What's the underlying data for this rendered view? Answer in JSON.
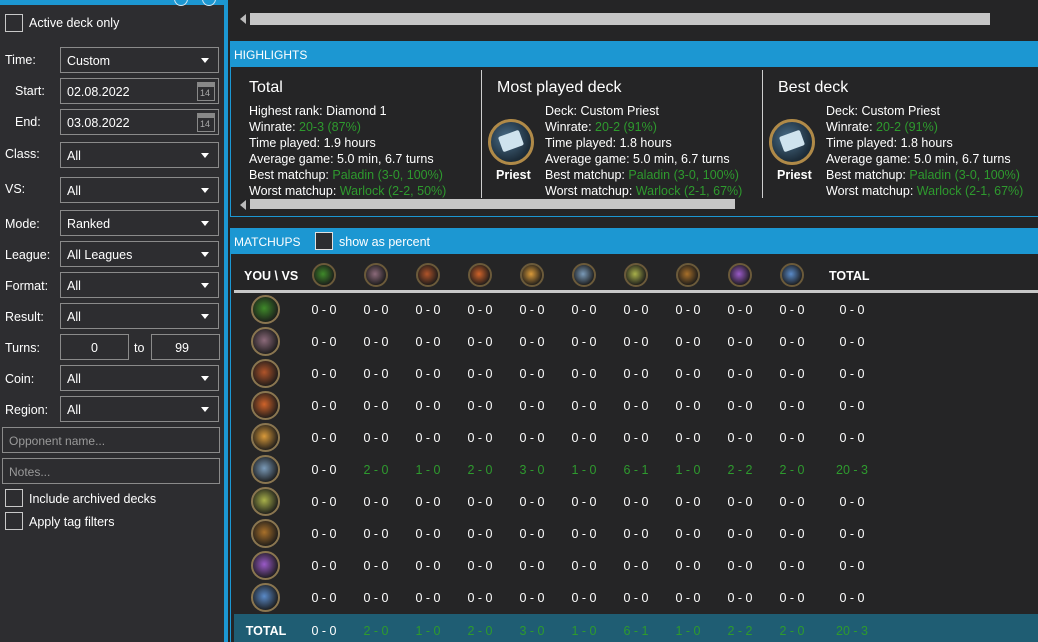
{
  "sidebar": {
    "active_deck_only": "Active deck only",
    "filters": {
      "time": {
        "label": "Time:",
        "value": "Custom"
      },
      "start": {
        "label": "Start:",
        "value": "02.08.2022",
        "cal": "14"
      },
      "end": {
        "label": "End:",
        "value": "03.08.2022",
        "cal": "14"
      },
      "class": {
        "label": "Class:",
        "value": "All"
      },
      "vs": {
        "label": "VS:",
        "value": "All"
      },
      "mode": {
        "label": "Mode:",
        "value": "Ranked"
      },
      "league": {
        "label": "League:",
        "value": "All Leagues"
      },
      "format": {
        "label": "Format:",
        "value": "All"
      },
      "result": {
        "label": "Result:",
        "value": "All"
      },
      "turns": {
        "label": "Turns:",
        "from": "0",
        "to_label": "to",
        "to": "99"
      },
      "coin": {
        "label": "Coin:",
        "value": "All"
      },
      "region": {
        "label": "Region:",
        "value": "All"
      }
    },
    "opponent_placeholder": "Opponent name...",
    "notes_placeholder": "Notes...",
    "include_archived": "Include archived decks",
    "apply_tag_filters": "Apply tag filters"
  },
  "highlights": {
    "header": "HIGHLIGHTS",
    "total": {
      "title": "Total",
      "highest_rank_label": "Highest rank:",
      "highest_rank": "Diamond 1",
      "winrate_label": "Winrate:",
      "winrate": "20-3 (87%)",
      "time_label": "Time played:",
      "time": "1.9 hours",
      "avg_label": "Average game:",
      "avg": "5.0 min, 6.7 turns",
      "best_label": "Best matchup:",
      "best": "Paladin (3-0, 100%)",
      "worst_label": "Worst matchup:",
      "worst": "Warlock (2-2, 50%)"
    },
    "most_played": {
      "title": "Most played deck",
      "class": "Priest",
      "deck_label": "Deck:",
      "deck": "Custom Priest",
      "winrate_label": "Winrate:",
      "winrate": "20-2 (91%)",
      "time_label": "Time played:",
      "time": "1.8 hours",
      "avg_label": "Average game:",
      "avg": "5.0 min, 6.7 turns",
      "best_label": "Best matchup:",
      "best": "Paladin (3-0, 100%)",
      "worst_label": "Worst matchup:",
      "worst": "Warlock (2-1, 67%)"
    },
    "best_deck": {
      "title": "Best deck",
      "class": "Priest",
      "deck_label": "Deck:",
      "deck": "Custom Priest",
      "winrate_label": "Winrate:",
      "winrate": "20-2 (91%)",
      "time_label": "Time played:",
      "time": "1.8 hours",
      "avg_label": "Average game:",
      "avg": "5.0 min, 6.7 turns",
      "best_label": "Best matchup:",
      "best": "Paladin (3-0, 100%)",
      "worst_label": "Worst matchup:",
      "worst": "Warlock (2-1, 67%)"
    }
  },
  "matchups": {
    "header": "MATCHUPS",
    "show_as_percent": "show as percent",
    "corner_label": "YOU \\ VS",
    "total_col": "TOTAL",
    "total_row": "TOTAL",
    "classes": [
      {
        "icon": "demon-hunter-icon",
        "color": "#3f8a2a"
      },
      {
        "icon": "druid-icon",
        "color": "#8c6a7a"
      },
      {
        "icon": "hunter-icon",
        "color": "#b0542a"
      },
      {
        "icon": "mage-icon",
        "color": "#d0632a"
      },
      {
        "icon": "paladin-icon",
        "color": "#d99a3a"
      },
      {
        "icon": "priest-icon",
        "color": "#7a9ab8"
      },
      {
        "icon": "rogue-icon",
        "color": "#a8b04a"
      },
      {
        "icon": "shaman-icon",
        "color": "#a8702a"
      },
      {
        "icon": "warlock-icon",
        "color": "#9a5ac8"
      },
      {
        "icon": "warrior-icon",
        "color": "#5a8ac8"
      }
    ],
    "rows": [
      {
        "cells": [
          "0 - 0",
          "0 - 0",
          "0 - 0",
          "0 - 0",
          "0 - 0",
          "0 - 0",
          "0 - 0",
          "0 - 0",
          "0 - 0",
          "0 - 0"
        ],
        "total": "0 - 0",
        "green": false
      },
      {
        "cells": [
          "0 - 0",
          "0 - 0",
          "0 - 0",
          "0 - 0",
          "0 - 0",
          "0 - 0",
          "0 - 0",
          "0 - 0",
          "0 - 0",
          "0 - 0"
        ],
        "total": "0 - 0",
        "green": false
      },
      {
        "cells": [
          "0 - 0",
          "0 - 0",
          "0 - 0",
          "0 - 0",
          "0 - 0",
          "0 - 0",
          "0 - 0",
          "0 - 0",
          "0 - 0",
          "0 - 0"
        ],
        "total": "0 - 0",
        "green": false
      },
      {
        "cells": [
          "0 - 0",
          "0 - 0",
          "0 - 0",
          "0 - 0",
          "0 - 0",
          "0 - 0",
          "0 - 0",
          "0 - 0",
          "0 - 0",
          "0 - 0"
        ],
        "total": "0 - 0",
        "green": false
      },
      {
        "cells": [
          "0 - 0",
          "0 - 0",
          "0 - 0",
          "0 - 0",
          "0 - 0",
          "0 - 0",
          "0 - 0",
          "0 - 0",
          "0 - 0",
          "0 - 0"
        ],
        "total": "0 - 0",
        "green": false
      },
      {
        "cells": [
          "0 - 0",
          "2 - 0",
          "1 - 0",
          "2 - 0",
          "3 - 0",
          "1 - 0",
          "6 - 1",
          "1 - 0",
          "2 - 2",
          "2 - 0"
        ],
        "total": "20 - 3",
        "green": true
      },
      {
        "cells": [
          "0 - 0",
          "0 - 0",
          "0 - 0",
          "0 - 0",
          "0 - 0",
          "0 - 0",
          "0 - 0",
          "0 - 0",
          "0 - 0",
          "0 - 0"
        ],
        "total": "0 - 0",
        "green": false
      },
      {
        "cells": [
          "0 - 0",
          "0 - 0",
          "0 - 0",
          "0 - 0",
          "0 - 0",
          "0 - 0",
          "0 - 0",
          "0 - 0",
          "0 - 0",
          "0 - 0"
        ],
        "total": "0 - 0",
        "green": false
      },
      {
        "cells": [
          "0 - 0",
          "0 - 0",
          "0 - 0",
          "0 - 0",
          "0 - 0",
          "0 - 0",
          "0 - 0",
          "0 - 0",
          "0 - 0",
          "0 - 0"
        ],
        "total": "0 - 0",
        "green": false
      },
      {
        "cells": [
          "0 - 0",
          "0 - 0",
          "0 - 0",
          "0 - 0",
          "0 - 0",
          "0 - 0",
          "0 - 0",
          "0 - 0",
          "0 - 0",
          "0 - 0"
        ],
        "total": "0 - 0",
        "green": false
      }
    ],
    "totals_row": {
      "cells": [
        "0 - 0",
        "2 - 0",
        "1 - 0",
        "2 - 0",
        "3 - 0",
        "1 - 0",
        "6 - 1",
        "1 - 0",
        "2 - 2",
        "2 - 0"
      ],
      "total": "20 - 3"
    }
  },
  "colors": {
    "accent": "#1c97d2",
    "win_green": "#2e9a2e",
    "total_row_bg": "#1f5d73"
  }
}
